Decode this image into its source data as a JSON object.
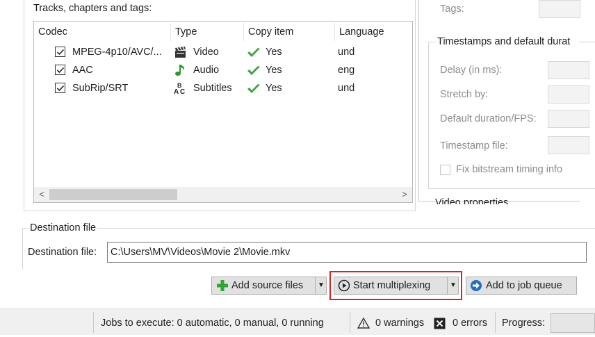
{
  "tracks_section": {
    "title": "Tracks, chapters and tags:",
    "columns": [
      "Codec",
      "Type",
      "Copy item",
      "Language"
    ],
    "rows": [
      {
        "codec": "MPEG-4p10/AVC/...",
        "type": "Video",
        "type_icon": "film-clapper-icon",
        "copy": "Yes",
        "language": "und",
        "checked": true
      },
      {
        "codec": "AAC",
        "type": "Audio",
        "type_icon": "music-note-icon",
        "copy": "Yes",
        "language": "eng",
        "checked": true
      },
      {
        "codec": "SubRip/SRT",
        "type": "Subtitles",
        "type_icon": "subtitles-abc-icon",
        "copy": "Yes",
        "language": "und",
        "checked": true
      }
    ],
    "scroll_left": "<",
    "scroll_right": ">"
  },
  "properties": {
    "tags_label": "Tags:",
    "timestamps_title": "Timestamps and default durat",
    "delay_label": "Delay (in ms):",
    "stretch_label": "Stretch by:",
    "default_duration_label": "Default duration/FPS:",
    "timestamp_file_label": "Timestamp file:",
    "fix_bitstream_label": "Fix bitstream timing info",
    "video_props_title": "Video properties"
  },
  "destination": {
    "group_title": "Destination file",
    "label": "Destination file:",
    "value": "C:\\Users\\MV\\Videos\\Movie 2\\Movie.mkv"
  },
  "buttons": {
    "add_source": "Add source files",
    "start_mux": "Start multiplexing",
    "add_job": "Add to job queue"
  },
  "status": {
    "jobs": "Jobs to execute:  0 automatic, 0 manual, 0 running",
    "warnings": "0 warnings",
    "errors": "0 errors",
    "progress_label": "Progress:"
  },
  "colors": {
    "highlight_border": "#e02020",
    "check_green": "#3aa83a",
    "add_green": "#2fa82f",
    "job_blue": "#1f6fc5"
  }
}
